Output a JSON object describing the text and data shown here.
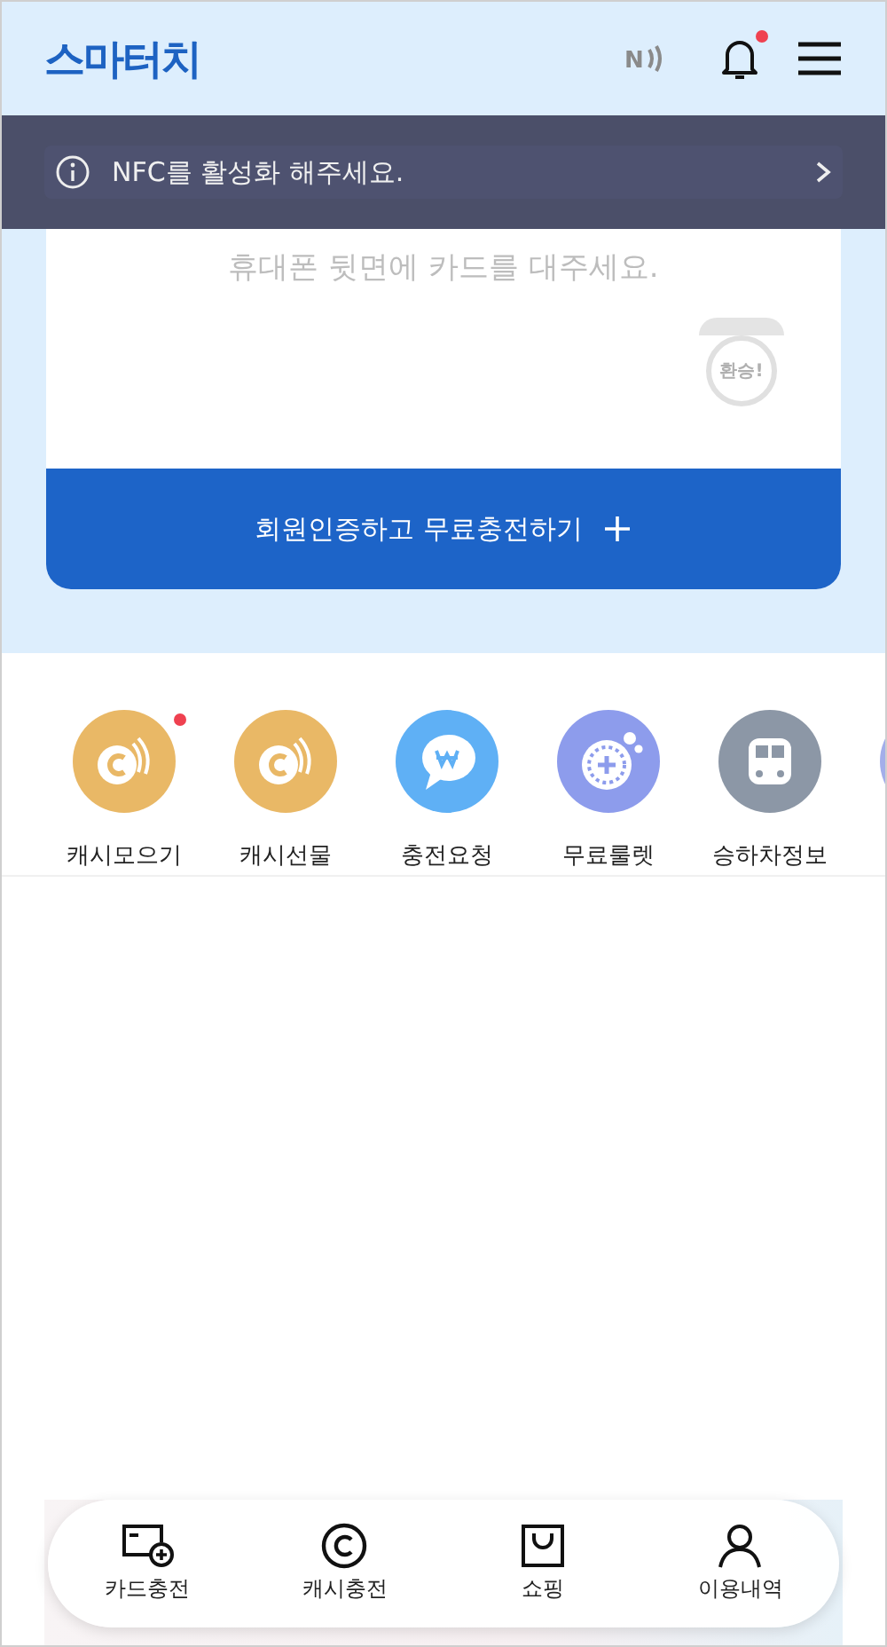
{
  "header": {
    "logo": "스마터치",
    "nfc_label": "N",
    "notification_badge": true
  },
  "toast": {
    "message": "NFC를 활성화 해주세요."
  },
  "card": {
    "hint": "휴대폰 뒷면에 카드를 대주세요.",
    "sticker": "환승!",
    "button": "회원인증하고 무료충전하기"
  },
  "shortcuts": [
    {
      "label": "캐시모으기",
      "badge": true
    },
    {
      "label": "캐시선물",
      "badge": false
    },
    {
      "label": "충전요청",
      "badge": false
    },
    {
      "label": "무료룰렛",
      "badge": false
    },
    {
      "label": "승하차정보",
      "badge": false
    }
  ],
  "bottom_nav": [
    {
      "label": "카드충전"
    },
    {
      "label": "캐시충전"
    },
    {
      "label": "쇼핑"
    },
    {
      "label": "이용내역"
    }
  ]
}
